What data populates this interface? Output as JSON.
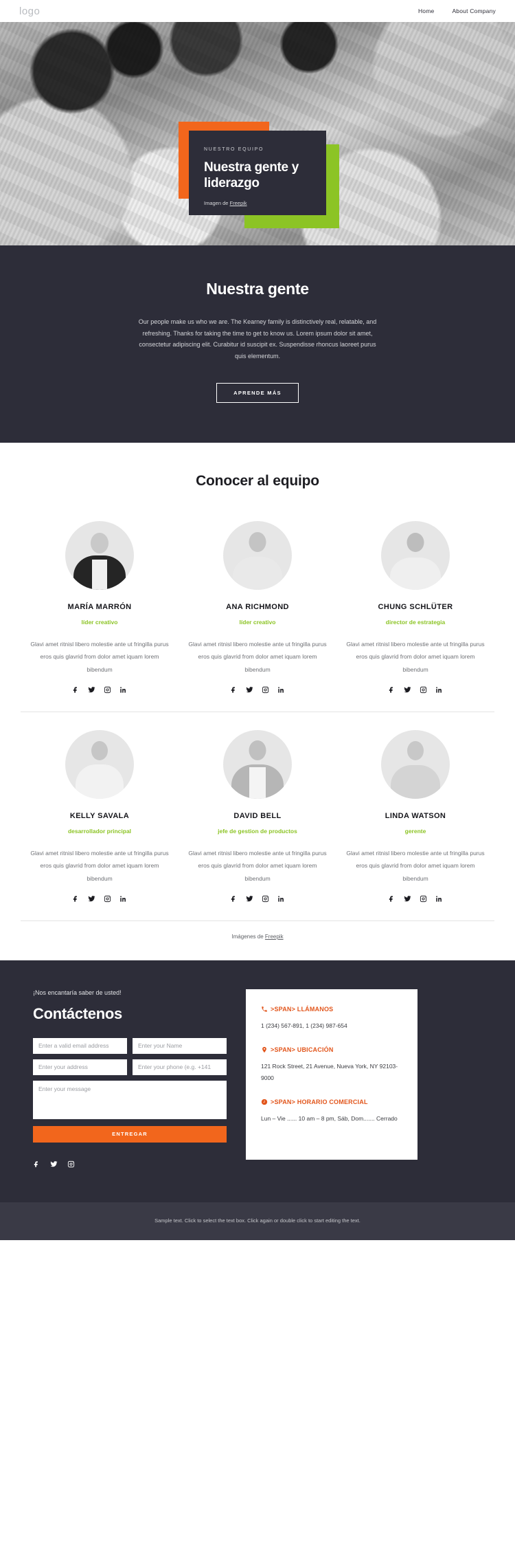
{
  "header": {
    "logo": "logo",
    "nav": [
      {
        "label": "Home"
      },
      {
        "label": "About Company"
      }
    ]
  },
  "hero": {
    "eyebrow": "NUESTRO EQUIPO",
    "title": "Nuestra gente y liderazgo",
    "credit_prefix": "Imagen de ",
    "credit_link": "Freepik",
    "accent_orange": "#f2661c",
    "accent_green": "#8cc425",
    "card_bg": "#2d2d39"
  },
  "intro": {
    "title": "Nuestra gente",
    "copy": "Our people make us who we are. The Kearney family is distinctively real, relatable, and refreshing. Thanks for taking the time to get to know us. Lorem ipsum dolor sit amet, consectetur adipiscing elit. Curabitur id suscipit ex. Suspendisse rhoncus laoreet purus quis elementum.",
    "button": "APRENDE MÁS"
  },
  "team": {
    "title": "Conocer al equipo",
    "role_color": "#8cc425",
    "bio": "Glavi amet ritnisl libero molestie ante ut fringilla purus eros quis glavrid from dolor amet iquam lorem bibendum",
    "socials": [
      "facebook-icon",
      "twitter-icon",
      "instagram-icon",
      "linkedin-icon"
    ],
    "members": [
      {
        "name": "MARÍA MARRÓN",
        "role": "líder creativo"
      },
      {
        "name": "ANA RICHMOND",
        "role": "líder creativo"
      },
      {
        "name": "CHUNG SCHLÜTER",
        "role": "director de estrategia"
      },
      {
        "name": "KELLY SAVALA",
        "role": "desarrollador principal"
      },
      {
        "name": "DAVID BELL",
        "role": "jefe de gestion de productos"
      },
      {
        "name": "LINDA WATSON",
        "role": "gerente"
      }
    ],
    "credit_prefix": "Imágenes de ",
    "credit_link": "Freepik"
  },
  "contact": {
    "eyebrow": "¡Nos encantaría saber de usted!",
    "title": "Contáctenos",
    "fields": {
      "email_placeholder": "Enter a valid email address",
      "name_placeholder": "Enter your Name",
      "address_placeholder": "Enter your address",
      "phone_placeholder": "Enter your phone (e.g. +141",
      "message_placeholder": "Enter your message"
    },
    "submit": "ENTREGAR",
    "socials": [
      "facebook-icon",
      "twitter-icon",
      "instagram-icon"
    ],
    "accent": "#f2661c",
    "info": [
      {
        "icon": "phone-icon",
        "heading": ">SPAN> LLÁMANOS",
        "body": "1 (234) 567-891, 1 (234) 987-654"
      },
      {
        "icon": "location-pin-icon",
        "heading": ">SPAN> UBICACIÓN",
        "body": "121 Rock Street, 21 Avenue, Nueva York, NY 92103-9000"
      },
      {
        "icon": "clock-icon",
        "heading": ">SPAN> HORARIO COMERCIAL",
        "body": "Lun – Vie ...... 10 am – 8 pm, Sáb, Dom....... Cerrado"
      }
    ]
  },
  "footer": {
    "text": "Sample text. Click to select the text box. Click again or double click to start editing the text."
  }
}
